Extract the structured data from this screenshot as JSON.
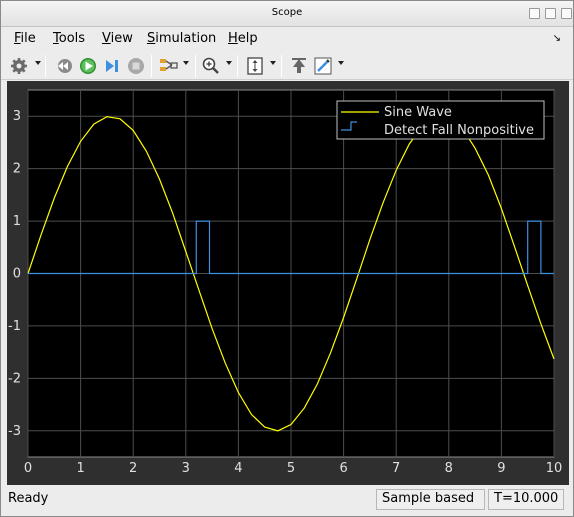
{
  "window": {
    "title": "Scope"
  },
  "menubar": {
    "items": [
      {
        "label": "File",
        "accel": "F",
        "rest": "ile"
      },
      {
        "label": "Tools",
        "accel": "T",
        "rest": "ools"
      },
      {
        "label": "View",
        "accel": "V",
        "rest": "iew"
      },
      {
        "label": "Simulation",
        "accel": "S",
        "rest": "imulation"
      },
      {
        "label": "Help",
        "accel": "H",
        "rest": "elp"
      }
    ]
  },
  "toolbar": {
    "icons": [
      "gear-icon",
      "step-back-icon",
      "run-icon",
      "step-forward-icon",
      "stop-icon",
      "signal-selector-icon",
      "zoom-in-icon",
      "scale-axes-icon",
      "highlight-icon",
      "style-icon"
    ]
  },
  "colors": {
    "plot_bg": "#000000",
    "panel_bg": "#2f2f2f",
    "grid": "#4d4d4d",
    "axis_text": "#e0e0e0",
    "sine": "#ffff00",
    "detect": "#3d8fe0"
  },
  "chart_data": {
    "type": "line",
    "xlim": [
      0,
      10
    ],
    "ylim": [
      -3.5,
      3.5
    ],
    "xticks": [
      "0",
      "1",
      "2",
      "3",
      "4",
      "5",
      "6",
      "7",
      "8",
      "9",
      "10"
    ],
    "yticks": [
      "3",
      "2",
      "1",
      "0",
      "-1",
      "-2",
      "-3"
    ],
    "grid": true,
    "legend_position": "top-right",
    "series": [
      {
        "name": "Sine Wave",
        "type": "line",
        "x": [
          0,
          0.25,
          0.5,
          0.75,
          1,
          1.25,
          1.5,
          1.75,
          2,
          2.25,
          2.5,
          2.75,
          3,
          3.25,
          3.5,
          3.75,
          4,
          4.25,
          4.5,
          4.75,
          5,
          5.25,
          5.5,
          5.75,
          6,
          6.25,
          6.5,
          6.75,
          7,
          7.25,
          7.5,
          7.75,
          8,
          8.25,
          8.5,
          8.75,
          9,
          9.25,
          9.5,
          9.75,
          10
        ],
        "y": [
          0,
          0.74,
          1.44,
          2.04,
          2.52,
          2.85,
          2.99,
          2.95,
          2.73,
          2.33,
          1.8,
          1.15,
          0.42,
          -0.32,
          -1.05,
          -1.71,
          -2.27,
          -2.69,
          -2.93,
          -3.0,
          -2.88,
          -2.57,
          -2.11,
          -1.52,
          -0.84,
          -0.1,
          0.65,
          1.35,
          1.97,
          2.47,
          2.81,
          2.98,
          2.97,
          2.78,
          2.39,
          1.88,
          1.24,
          0.51,
          -0.23,
          -0.96,
          -1.63
        ]
      },
      {
        "name": "Detect Fall Nonpositive",
        "type": "step",
        "x": [
          0,
          3.2,
          3.2,
          3.45,
          3.45,
          9.5,
          9.5,
          9.75,
          9.75,
          10
        ],
        "y": [
          0,
          0,
          1,
          1,
          0,
          0,
          1,
          1,
          0,
          0
        ]
      }
    ]
  },
  "status": {
    "ready": "Ready",
    "mode": "Sample based",
    "time": "T=10.000"
  }
}
